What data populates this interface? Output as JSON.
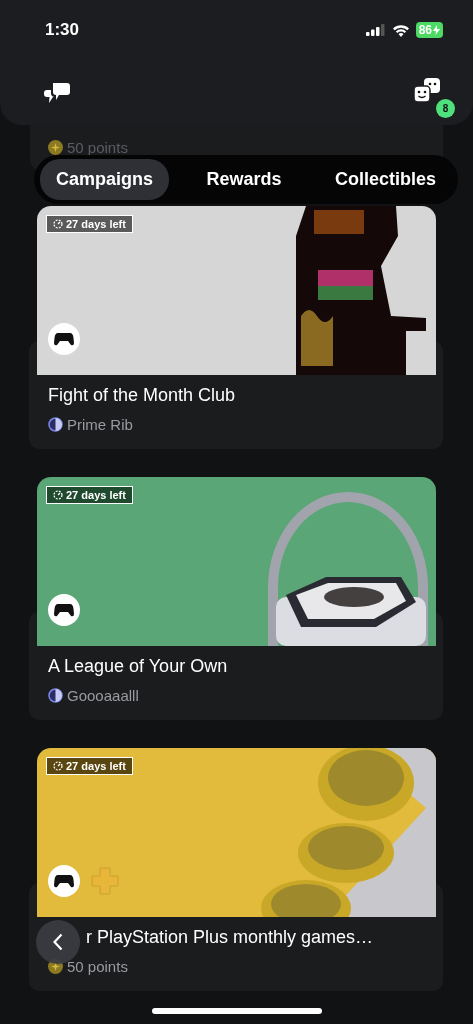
{
  "status_bar": {
    "time": "1:30",
    "battery": "86"
  },
  "header": {
    "notification_count": "8"
  },
  "peek_card": {
    "reward": {
      "kind": "points",
      "text": "50 points"
    }
  },
  "tabs": [
    {
      "label": "Campaigns",
      "selected": true
    },
    {
      "label": "Rewards",
      "selected": false
    },
    {
      "label": "Collectibles",
      "selected": false
    }
  ],
  "campaigns": [
    {
      "kind": "fight",
      "countdown": "27 days left",
      "plus": false,
      "title": "Fight of the Month Club",
      "reward": {
        "kind": "badge",
        "text": "Prime Rib"
      }
    },
    {
      "kind": "sports",
      "countdown": "27 days left",
      "plus": false,
      "title": "A League of Your Own",
      "reward": {
        "kind": "badge",
        "text": "Goooaaalll"
      }
    },
    {
      "kind": "coins",
      "countdown": "27 days left",
      "plus": true,
      "title": "r PlayStation Plus monthly games…",
      "reward": {
        "kind": "points",
        "text": "50 points"
      }
    }
  ]
}
